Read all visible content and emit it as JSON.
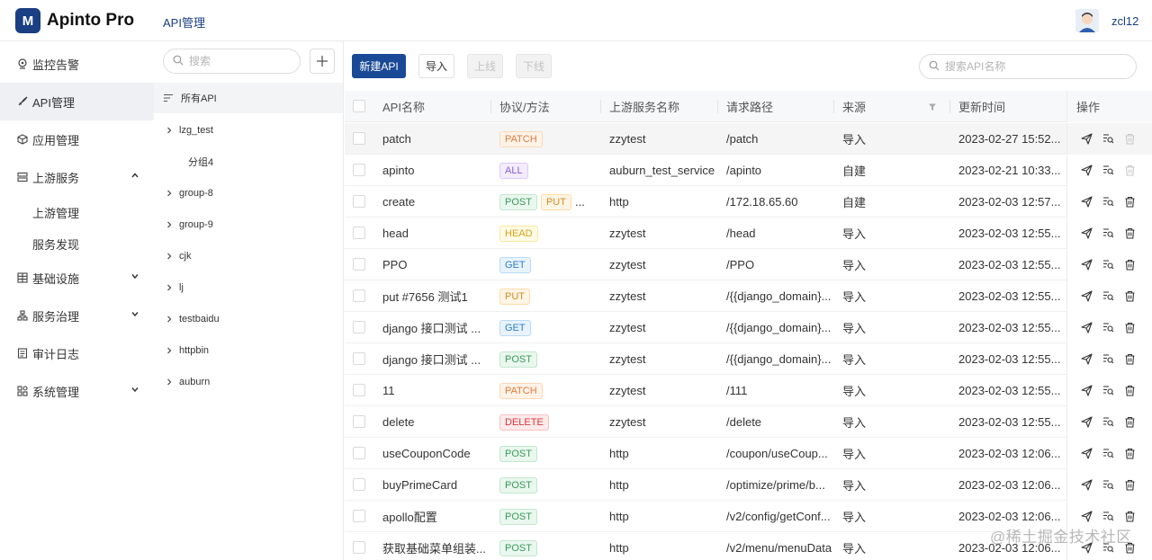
{
  "app": {
    "logo_text": "Apinto Pro",
    "logo_mark": "M"
  },
  "header": {
    "title": "API管理",
    "username": "zcl12"
  },
  "sidebar": {
    "items": [
      {
        "label": "监控告警",
        "icon": "monitor-icon"
      },
      {
        "label": "API管理",
        "icon": "rocket-icon",
        "active": true
      },
      {
        "label": "应用管理",
        "icon": "cube-icon"
      },
      {
        "label": "上游服务",
        "icon": "server-icon",
        "expanded": true
      },
      {
        "label": "基础设施",
        "icon": "grid-icon"
      },
      {
        "label": "服务治理",
        "icon": "org-icon"
      },
      {
        "label": "审计日志",
        "icon": "log-icon"
      },
      {
        "label": "系统管理",
        "icon": "apps-icon"
      }
    ],
    "sub_items": [
      "上游管理",
      "服务发现"
    ]
  },
  "groups": {
    "search_placeholder": "搜索",
    "all_label": "所有API",
    "tree": [
      {
        "label": "lzg_test",
        "has_children": true
      },
      {
        "label": "分组4",
        "has_children": false
      },
      {
        "label": "group-8",
        "has_children": true
      },
      {
        "label": "group-9",
        "has_children": true
      },
      {
        "label": "cjk",
        "has_children": true
      },
      {
        "label": "lj",
        "has_children": true
      },
      {
        "label": "testbaidu",
        "has_children": true
      },
      {
        "label": "httpbin",
        "has_children": true
      },
      {
        "label": "auburn",
        "has_children": true
      }
    ]
  },
  "toolbar": {
    "new_api": "新建API",
    "import": "导入",
    "online": "上线",
    "offline": "下线",
    "search_placeholder": "搜索API名称"
  },
  "table": {
    "columns": [
      "API名称",
      "协议/方法",
      "上游服务名称",
      "请求路径",
      "来源",
      "更新时间",
      "操作"
    ],
    "rows": [
      {
        "name": "patch",
        "methods": [
          "PATCH"
        ],
        "more": "",
        "upstream": "zzytest",
        "path": "/patch",
        "source": "导入",
        "time": "2023-02-27 15:52...",
        "delete_disabled": true
      },
      {
        "name": "apinto",
        "methods": [
          "ALL"
        ],
        "more": "",
        "upstream": "auburn_test_service",
        "path": "/apinto",
        "source": "自建",
        "time": "2023-02-21 10:33...",
        "delete_disabled": true
      },
      {
        "name": "create",
        "methods": [
          "POST",
          "PUT"
        ],
        "more": "...",
        "upstream": "http",
        "path": "/172.18.65.60",
        "source": "自建",
        "time": "2023-02-03 12:57...",
        "delete_disabled": false
      },
      {
        "name": "head",
        "methods": [
          "HEAD"
        ],
        "more": "",
        "upstream": "zzytest",
        "path": "/head",
        "source": "导入",
        "time": "2023-02-03 12:55...",
        "delete_disabled": false
      },
      {
        "name": "PPO",
        "methods": [
          "GET"
        ],
        "more": "",
        "upstream": "zzytest",
        "path": "/PPO",
        "source": "导入",
        "time": "2023-02-03 12:55...",
        "delete_disabled": false
      },
      {
        "name": "put #7656 测试1",
        "methods": [
          "PUT"
        ],
        "more": "",
        "upstream": "zzytest",
        "path": "/{{django_domain}...",
        "source": "导入",
        "time": "2023-02-03 12:55...",
        "delete_disabled": false
      },
      {
        "name": "django 接口测试 ...",
        "methods": [
          "GET"
        ],
        "more": "",
        "upstream": "zzytest",
        "path": "/{{django_domain}...",
        "source": "导入",
        "time": "2023-02-03 12:55...",
        "delete_disabled": false
      },
      {
        "name": "django 接口测试 ...",
        "methods": [
          "POST"
        ],
        "more": "",
        "upstream": "zzytest",
        "path": "/{{django_domain}...",
        "source": "导入",
        "time": "2023-02-03 12:55...",
        "delete_disabled": false
      },
      {
        "name": "11",
        "methods": [
          "PATCH"
        ],
        "more": "",
        "upstream": "zzytest",
        "path": "/111",
        "source": "导入",
        "time": "2023-02-03 12:55...",
        "delete_disabled": false
      },
      {
        "name": "delete",
        "methods": [
          "DELETE"
        ],
        "more": "",
        "upstream": "zzytest",
        "path": "/delete",
        "source": "导入",
        "time": "2023-02-03 12:55...",
        "delete_disabled": false
      },
      {
        "name": "useCouponCode",
        "methods": [
          "POST"
        ],
        "more": "",
        "upstream": "http",
        "path": "/coupon/useCoup...",
        "source": "导入",
        "time": "2023-02-03 12:06...",
        "delete_disabled": false
      },
      {
        "name": "buyPrimeCard",
        "methods": [
          "POST"
        ],
        "more": "",
        "upstream": "http",
        "path": "/optimize/prime/b...",
        "source": "导入",
        "time": "2023-02-03 12:06...",
        "delete_disabled": false
      },
      {
        "name": "apollo配置",
        "methods": [
          "POST"
        ],
        "more": "",
        "upstream": "http",
        "path": "/v2/config/getConf...",
        "source": "导入",
        "time": "2023-02-03 12:06...",
        "delete_disabled": false
      },
      {
        "name": "获取基础菜单组装...",
        "methods": [
          "POST"
        ],
        "more": "",
        "upstream": "http",
        "path": "/v2/menu/menuData",
        "source": "导入",
        "time": "2023-02-03 12:06...",
        "delete_disabled": false
      }
    ]
  },
  "watermark": "@稀土掘金技术社区",
  "colors": {
    "primary": "#1a4a96",
    "brand_text": "#1a3f82",
    "active_nav_bg": "#eef0f3"
  }
}
